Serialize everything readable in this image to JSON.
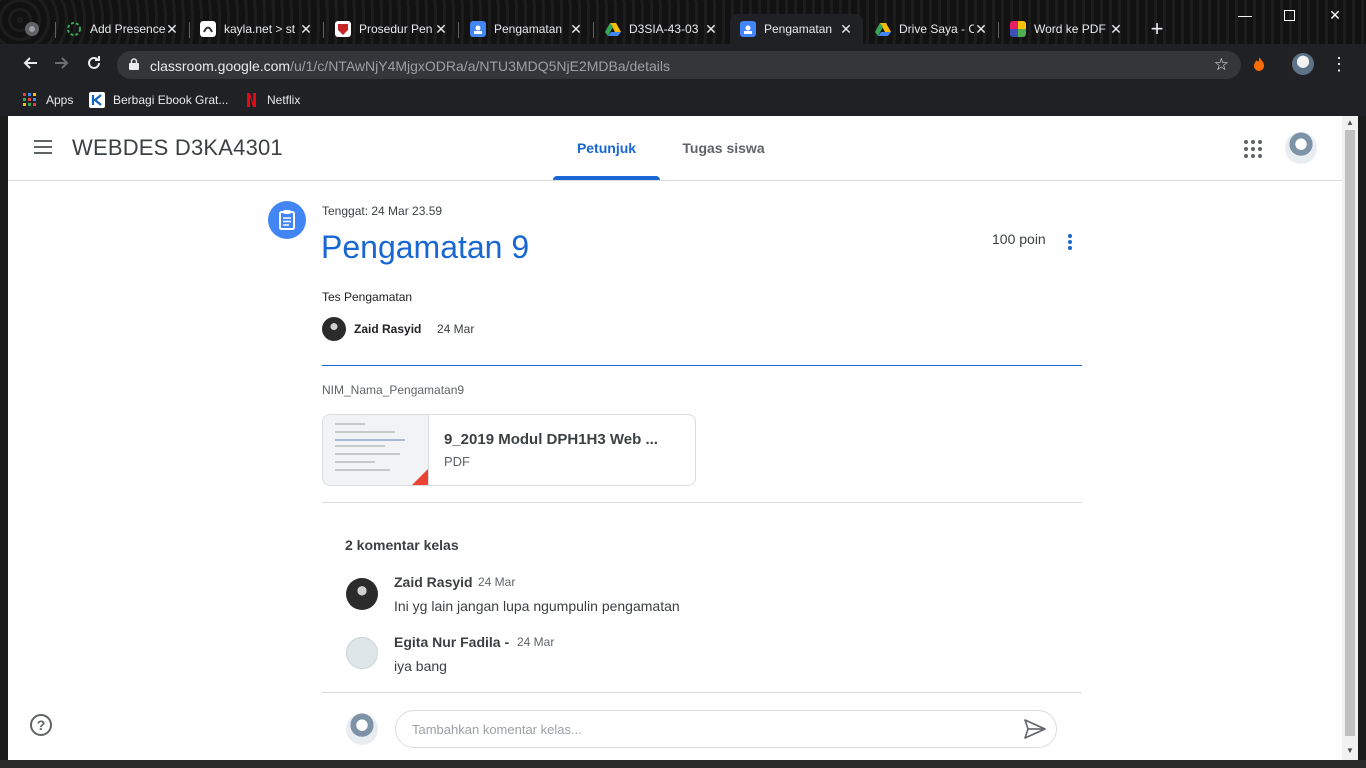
{
  "browser": {
    "tabs": [
      {
        "title": "",
        "icon": "globe-icon",
        "color": "#5f6368"
      },
      {
        "title": "Add Presence",
        "icon": "presence-icon",
        "color": "#34a853"
      },
      {
        "title": "kayla.net > st",
        "icon": "kayla-icon",
        "color": "#ffffff"
      },
      {
        "title": "Prosedur Pen",
        "icon": "university-icon",
        "color": "#c62828"
      },
      {
        "title": "Pengamatan",
        "icon": "classroom-icon",
        "color": "#4285f4"
      },
      {
        "title": "D3SIA-43-03",
        "icon": "drive-icon",
        "color": "#fbbc04"
      },
      {
        "title": "Pengamatan",
        "icon": "classroom-icon",
        "color": "#4285f4",
        "active": true
      },
      {
        "title": "Drive Saya - C",
        "icon": "drive-icon",
        "color": "#fbbc04"
      },
      {
        "title": "Word ke PDF",
        "icon": "word-to-pdf-icon",
        "color": "#e91e63"
      }
    ],
    "url_host": "classroom.google.com",
    "url_path": "/u/1/c/NTAwNjY4MjgxODRa/a/NTU3MDQ5NjE2MDBa/details",
    "bookmarks": [
      {
        "label": "Apps",
        "icon": "apps-icon"
      },
      {
        "label": "Berbagi Ebook Grat...",
        "icon": "ebook-icon"
      },
      {
        "label": "Netflix",
        "icon": "netflix-icon"
      }
    ]
  },
  "header": {
    "class_name": "WEBDES D3KA4301",
    "tabs": [
      {
        "label": "Petunjuk",
        "active": true
      },
      {
        "label": "Tugas siswa",
        "active": false
      }
    ]
  },
  "assignment": {
    "due": "Tenggat: 24 Mar 23.59",
    "title": "Pengamatan 9",
    "points": "100 poin",
    "description": "Tes Pengamatan",
    "author": "Zaid Rasyid",
    "posted": "24 Mar",
    "attachment_label": "NIM_Nama_Pengamatan9",
    "attachment": {
      "name": "9_2019 Modul DPH1H3 Web ...",
      "type": "PDF"
    }
  },
  "comments": {
    "title": "2 komentar kelas",
    "items": [
      {
        "name": "Zaid Rasyid",
        "date": "24 Mar",
        "text": "Ini yg lain jangan lupa ngumpulin pengamatan"
      },
      {
        "name": "Egita Nur Fadila -",
        "date": "24 Mar",
        "text": "iya bang"
      }
    ],
    "placeholder": "Tambahkan komentar kelas..."
  },
  "colors": {
    "accent": "#1967d2",
    "chrome_dark": "#202124"
  }
}
